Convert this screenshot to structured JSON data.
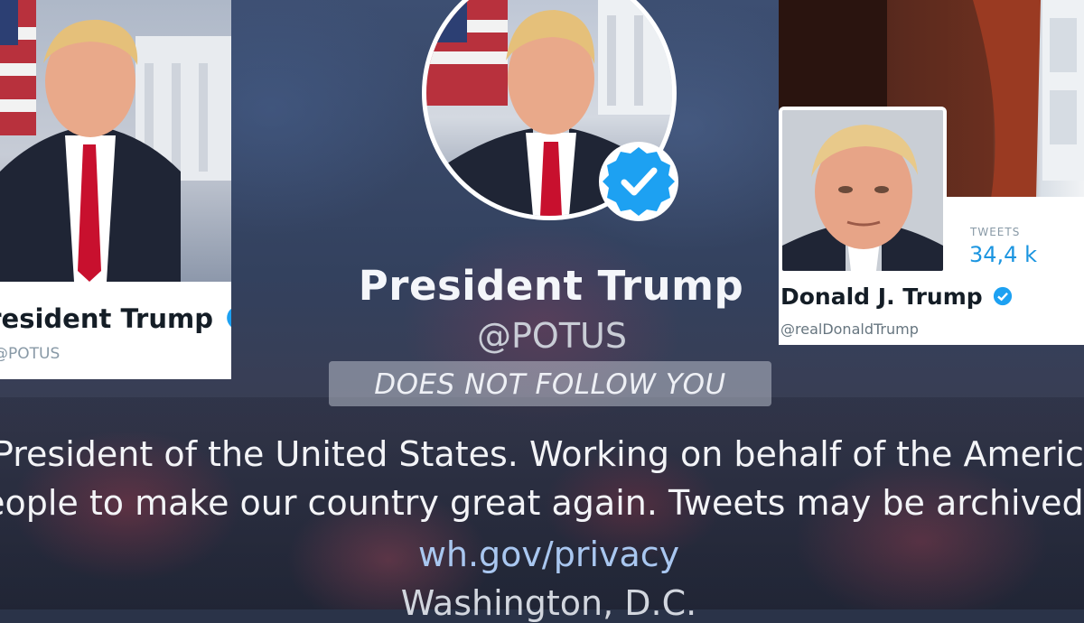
{
  "left_profile": {
    "name": "President Trump",
    "handle": "@POTUS"
  },
  "main_profile": {
    "name": "President Trump",
    "handle": "@POTUS",
    "follow_status": "DOES NOT FOLLOW YOU",
    "bio_line1": "President of the United States. Working on behalf of the American",
    "bio_line2": "people to make our country great again. Tweets may be archived:",
    "link": "wh.gov/privacy",
    "location": "Washington, D.C."
  },
  "right_profile": {
    "name": "Donald J. Trump",
    "handle": "@realDonaldTrump",
    "tweets_label": "TWEETS",
    "tweets_count": "34,4 k"
  },
  "colors": {
    "verified": "#1da1f2",
    "link": "#a9c7f0",
    "stat": "#1b95e0"
  },
  "icons": [
    "verified-badge-icon"
  ]
}
